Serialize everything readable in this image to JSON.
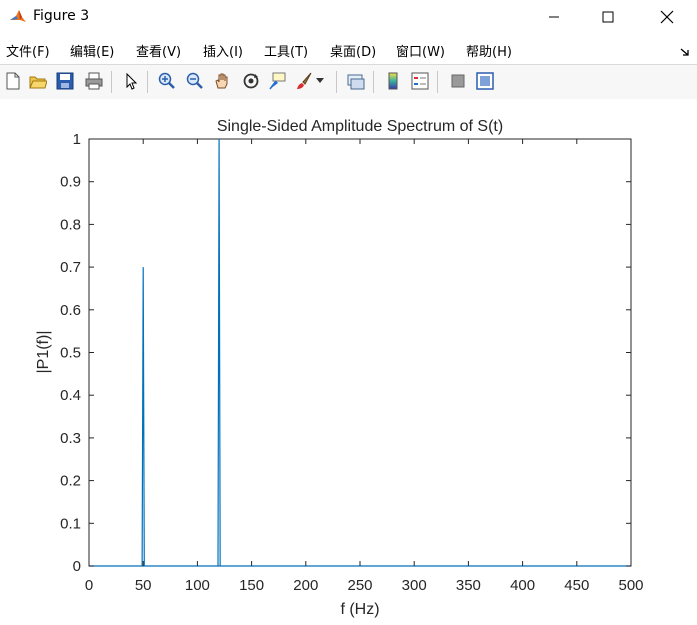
{
  "window": {
    "title": "Figure 3",
    "icon": "matlab-icon",
    "controls": [
      "minimize-icon",
      "maximize-icon",
      "close-icon"
    ]
  },
  "menu": {
    "items": [
      {
        "label": "文件(F)"
      },
      {
        "label": "编辑(E)"
      },
      {
        "label": "查看(V)"
      },
      {
        "label": "插入(I)"
      },
      {
        "label": "工具(T)"
      },
      {
        "label": "桌面(D)"
      },
      {
        "label": "窗口(W)"
      },
      {
        "label": "帮助(H)"
      }
    ],
    "dock_icon": "dock-arrow-icon"
  },
  "toolbar": {
    "tools": [
      "new-figure-icon",
      "open-file-icon",
      "save-icon",
      "print-icon",
      "select-pointer-icon",
      "zoom-in-icon",
      "zoom-out-icon",
      "pan-hand-icon",
      "rotate-3d-icon",
      "data-cursor-icon",
      "brush-icon",
      "brush-dropdown-icon",
      "link-plot-icon",
      "colorbar-icon",
      "legend-icon",
      "hide-plot-tools-icon",
      "show-plot-tools-icon"
    ]
  },
  "colors": {
    "line": "#0072bd",
    "axis": "#262626",
    "background": "#ffffff"
  },
  "chart_data": {
    "type": "line",
    "title": "Single-Sided Amplitude Spectrum of S(t)",
    "xlabel": "f (Hz)",
    "ylabel": "|P1(f)|",
    "xlim": [
      0,
      500
    ],
    "ylim": [
      0,
      1
    ],
    "xticks": [
      0,
      50,
      100,
      150,
      200,
      250,
      300,
      350,
      400,
      450,
      500
    ],
    "yticks": [
      0,
      0.1,
      0.2,
      0.3,
      0.4,
      0.5,
      0.6,
      0.7,
      0.8,
      0.9,
      1
    ],
    "grid": false,
    "series": [
      {
        "color": "#0072bd",
        "x": [
          0,
          49,
          50,
          51,
          119,
          120,
          121,
          500
        ],
        "y": [
          0,
          0,
          0.7,
          0,
          0,
          1.0,
          0,
          0
        ]
      }
    ]
  }
}
